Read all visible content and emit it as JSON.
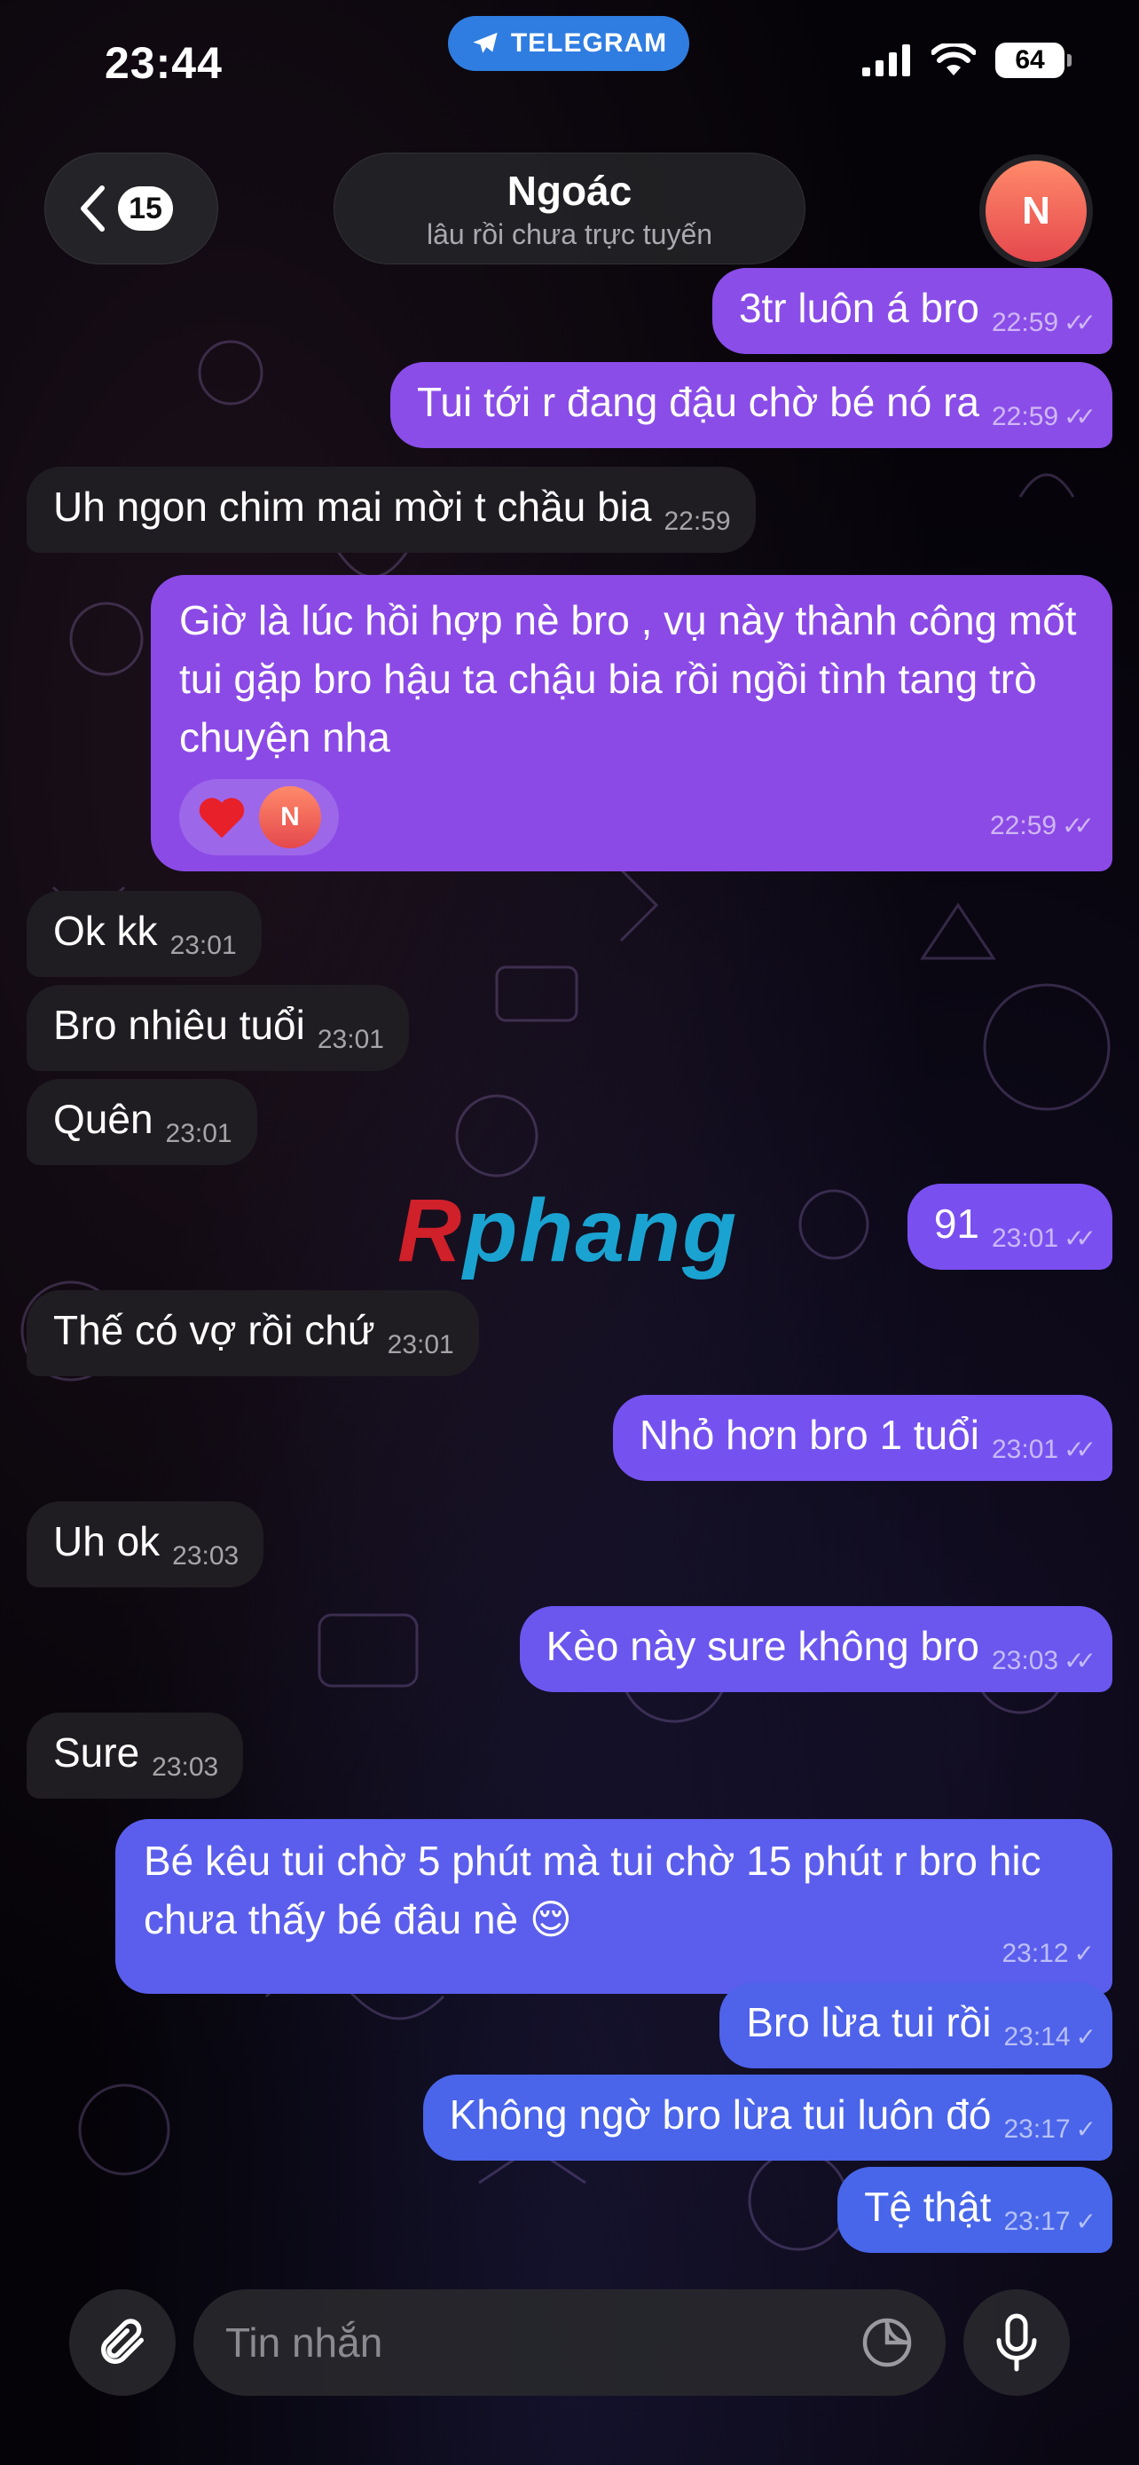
{
  "status_bar": {
    "time": "23:44",
    "app_pill": "TELEGRAM",
    "battery": "64"
  },
  "header": {
    "back_count": "15",
    "chat_name": "Ngoác",
    "chat_status": "lâu rồi chưa trực tuyến",
    "avatar_initial": "N"
  },
  "watermark": {
    "part1": "R",
    "part2": "phang"
  },
  "messages": [
    {
      "dir": "out",
      "text": "3tr luôn á bro",
      "time": "22:59",
      "ticks": "✓✓",
      "color": "#8a4de8"
    },
    {
      "dir": "out",
      "text": "Tui tới r đang đậu chờ bé nó ra",
      "time": "22:59",
      "ticks": "✓✓",
      "color": "#8a4de8"
    },
    {
      "dir": "in",
      "text": "Uh ngon chim mai mời t chầu bia",
      "time": "22:59"
    },
    {
      "dir": "out",
      "text": "Giờ là lúc hồi hợp nè bro , vụ này thành công mốt tui gặp bro hậu ta chậu bia rồi ngồi tình tang trò chuyện nha",
      "time": "22:59",
      "ticks": "✓✓",
      "color": "#8b4ae6",
      "reaction": {
        "emoji": "❤️",
        "initial": "N"
      }
    },
    {
      "dir": "in",
      "text": "Ok kk",
      "time": "23:01"
    },
    {
      "dir": "in",
      "text": "Bro nhiêu tuổi",
      "time": "23:01"
    },
    {
      "dir": "in",
      "text": "Quên",
      "time": "23:01"
    },
    {
      "dir": "out",
      "text": "91",
      "time": "23:01",
      "ticks": "✓✓",
      "color": "#7a4ff0"
    },
    {
      "dir": "in",
      "text": "Thế có vợ rồi chứ",
      "time": "23:01"
    },
    {
      "dir": "out",
      "text": "Nhỏ hơn bro 1 tuổi",
      "time": "23:01",
      "ticks": "✓✓",
      "color": "#7552f0"
    },
    {
      "dir": "in",
      "text": "Uh ok",
      "time": "23:03"
    },
    {
      "dir": "out",
      "text": "Kèo này sure không bro",
      "time": "23:03",
      "ticks": "✓✓",
      "color": "#6b56ee"
    },
    {
      "dir": "in",
      "text": "Sure",
      "time": "23:03"
    },
    {
      "dir": "out",
      "text": "Bé kêu tui chờ 5 phút mà tui chờ 15 phút r bro hic chưa thấy bé đâu nè 😌",
      "time": "23:12",
      "ticks": "✓",
      "color": "#5b5eec"
    },
    {
      "dir": "out",
      "text": "Bro lừa tui rồi",
      "time": "23:14",
      "ticks": "✓",
      "color": "#4f62ea"
    },
    {
      "dir": "out",
      "text": "Không ngờ bro lừa tui luôn đó",
      "time": "23:17",
      "ticks": "✓",
      "color": "#4a64ea"
    },
    {
      "dir": "out",
      "text": "Tệ thật",
      "time": "23:17",
      "ticks": "✓",
      "color": "#4866ea"
    }
  ],
  "composer": {
    "placeholder": "Tin nhắn"
  },
  "icons": [
    "telegram-plane-icon",
    "signal-icon",
    "wifi-icon",
    "battery-icon",
    "chevron-left-icon",
    "heart-icon",
    "paperclip-icon",
    "sticker-icon",
    "microphone-icon"
  ]
}
